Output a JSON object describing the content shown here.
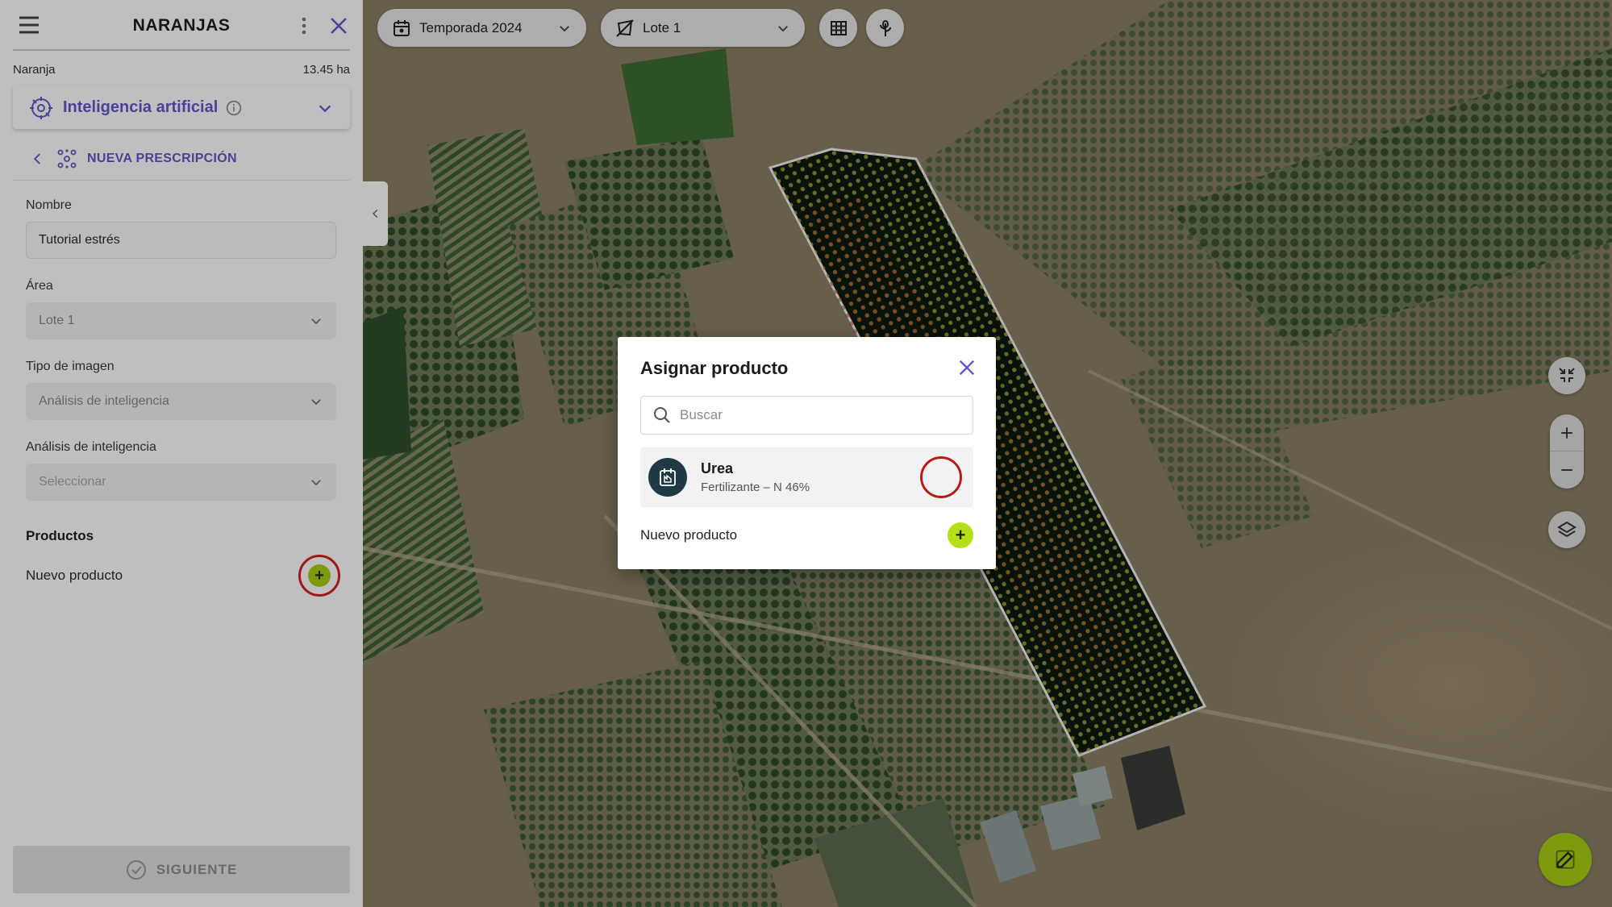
{
  "sidebar": {
    "title": "NARANJAS",
    "crop": "Naranja",
    "area": "13.45 ha",
    "module": {
      "label": "Inteligencia artificial"
    },
    "breadcrumb": {
      "label": "NUEVA PRESCRIPCIÓN"
    },
    "form": {
      "name": {
        "label": "Nombre",
        "value": "Tutorial estrés"
      },
      "area": {
        "label": "Área",
        "value": "Lote 1"
      },
      "image_type": {
        "label": "Tipo de imagen",
        "value": "Análisis de inteligencia"
      },
      "analysis": {
        "label": "Análisis de inteligencia",
        "placeholder": "Seleccionar"
      }
    },
    "products": {
      "title": "Productos",
      "new_label": "Nuevo producto"
    },
    "next_label": "SIGUIENTE"
  },
  "map_toolbar": {
    "season": "Temporada 2024",
    "lot": "Lote 1"
  },
  "modal": {
    "title": "Asignar producto",
    "search_placeholder": "Buscar",
    "products": [
      {
        "name": "Urea",
        "description": "Fertilizante – N 46%"
      }
    ],
    "new_product_label": "Nuevo producto"
  },
  "colors": {
    "accent": "#5f59c9",
    "add_green": "#a8cf12",
    "highlight_red": "#d42020"
  }
}
